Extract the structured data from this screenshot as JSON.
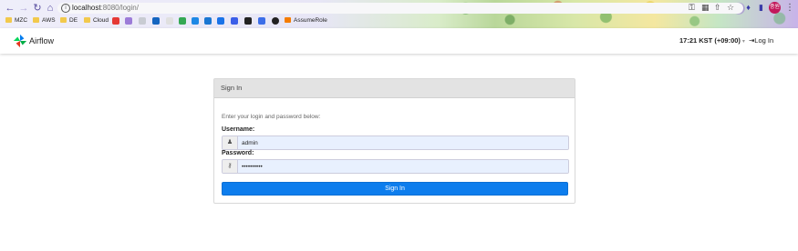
{
  "browser": {
    "url_host": "localhost",
    "url_rest": ":8080/login/",
    "bookmarks": [
      "MZC",
      "AWS",
      "DE",
      "Cloud",
      "AssumeRole"
    ],
    "profile_initials": "중원",
    "accent": "#5a4fa0"
  },
  "navbar": {
    "brand": "Airflow",
    "time": "17:21 KST (+09:00)",
    "login": "Log In"
  },
  "login": {
    "title": "Sign In",
    "hint": "Enter your login and password below:",
    "username_label": "Username:",
    "username_value": "admin",
    "password_label": "Password:",
    "password_value": "••••••••••",
    "submit": "Sign In",
    "button_color": "#0d7ded"
  }
}
